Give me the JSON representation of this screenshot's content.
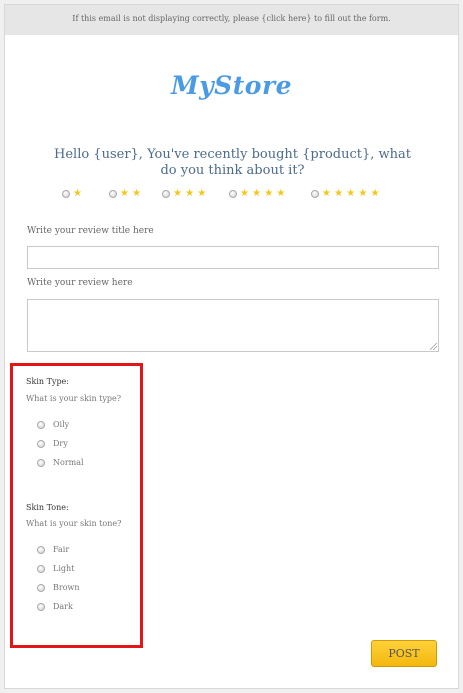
{
  "header": {
    "notice": "If this email is not displaying correctly, please {click here} to fill out the form."
  },
  "brand": {
    "logo_text": "MyStore",
    "color": "#4a9be3"
  },
  "question": {
    "text": "Hello {user}, You've recently bought {product}, what do you think about it?"
  },
  "rating": {
    "options": [
      {
        "stars": "★"
      },
      {
        "stars": "★ ★"
      },
      {
        "stars": "★ ★ ★"
      },
      {
        "stars": "★ ★ ★ ★"
      },
      {
        "stars": "★ ★ ★ ★ ★"
      }
    ],
    "star_color": "#f3c71c"
  },
  "review": {
    "title_label": "Write your review title here",
    "title_value": "",
    "body_label": "Write your review here",
    "body_value": ""
  },
  "attributes": {
    "skin_type": {
      "title": "Skin Type:",
      "question": "What is your skin type?",
      "options": [
        "Oily",
        "Dry",
        "Normal"
      ]
    },
    "skin_tone": {
      "title": "Skin Tone:",
      "question": "What is your skin tone?",
      "options": [
        "Fair",
        "Light",
        "Brown",
        "Dark"
      ]
    },
    "highlight_color": "#e21616"
  },
  "actions": {
    "post_label": "POST",
    "post_color": "#f4b70e"
  }
}
